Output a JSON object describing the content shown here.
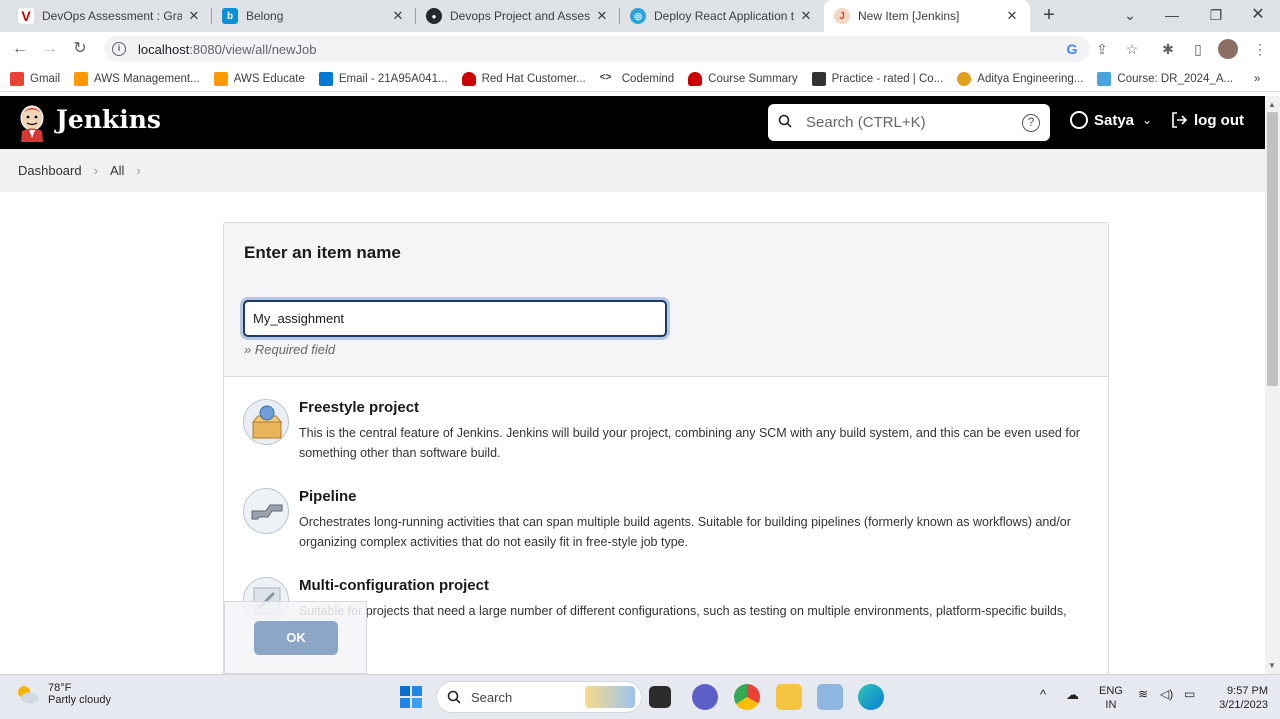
{
  "browser": {
    "tabs": [
      {
        "title": "DevOps Assessment : Graded",
        "fav_color": "#cc0000",
        "fav_glyph": "V"
      },
      {
        "title": "Belong",
        "fav_color": "#0b8fd9",
        "fav_glyph": "b"
      },
      {
        "title": "Devops Project and Assessme",
        "fav_color": "#24292e",
        "fav_glyph": "●"
      },
      {
        "title": "Deploy React Application to",
        "fav_color": "#29a3e1",
        "fav_glyph": "◎"
      },
      {
        "title": "New Item [Jenkins]",
        "fav_color": "#d24939",
        "fav_glyph": "J",
        "active": true
      }
    ],
    "url_host": "localhost",
    "url_path": ":8080/view/all/newJob",
    "bookmarks": [
      {
        "label": "Gmail",
        "color": "#ea4335"
      },
      {
        "label": "AWS Management...",
        "color": "#ff9900"
      },
      {
        "label": "AWS Educate",
        "color": "#ff9900"
      },
      {
        "label": "Email - 21A95A041...",
        "color": "#0078d4"
      },
      {
        "label": "Red Hat Customer...",
        "color": "#cc0000"
      },
      {
        "label": "Codemind",
        "color": "#555555"
      },
      {
        "label": "Course Summary",
        "color": "#cc0000"
      },
      {
        "label": "Practice - rated | Co...",
        "color": "#333333"
      },
      {
        "label": "Aditya Engineering...",
        "color": "#e0a020"
      },
      {
        "label": "Course: DR_2024_A...",
        "color": "#4aa3df"
      }
    ],
    "more_bookmarks": "»"
  },
  "jenkins": {
    "brand": "Jenkins",
    "search_placeholder": "Search (CTRL+K)",
    "help_glyph": "?",
    "user": "Satya",
    "logout": "log out",
    "breadcrumbs": [
      "Dashboard",
      "All"
    ],
    "panel_title": "Enter an item name",
    "item_name_value": "My_assighment",
    "required_note": "» Required field",
    "item_types": [
      {
        "name": "Freestyle project",
        "desc": "This is the central feature of Jenkins. Jenkins will build your project, combining any SCM with any build system, and this can be even used for something other than software build."
      },
      {
        "name": "Pipeline",
        "desc": "Orchestrates long-running activities that can span multiple build agents. Suitable for building pipelines (formerly known as workflows) and/or organizing complex activities that do not easily fit in free-style job type."
      },
      {
        "name": "Multi-configuration project",
        "desc": "Suitable for projects that need a large number of different configurations, such as testing on multiple environments, platform-specific builds, etc."
      }
    ],
    "ok_label": "OK"
  },
  "taskbar": {
    "temp": "78°F",
    "condition": "Partly cloudy",
    "search_label": "Search",
    "lang_top": "ENG",
    "lang_bottom": "IN",
    "time": "9:57 PM",
    "date": "3/21/2023"
  }
}
